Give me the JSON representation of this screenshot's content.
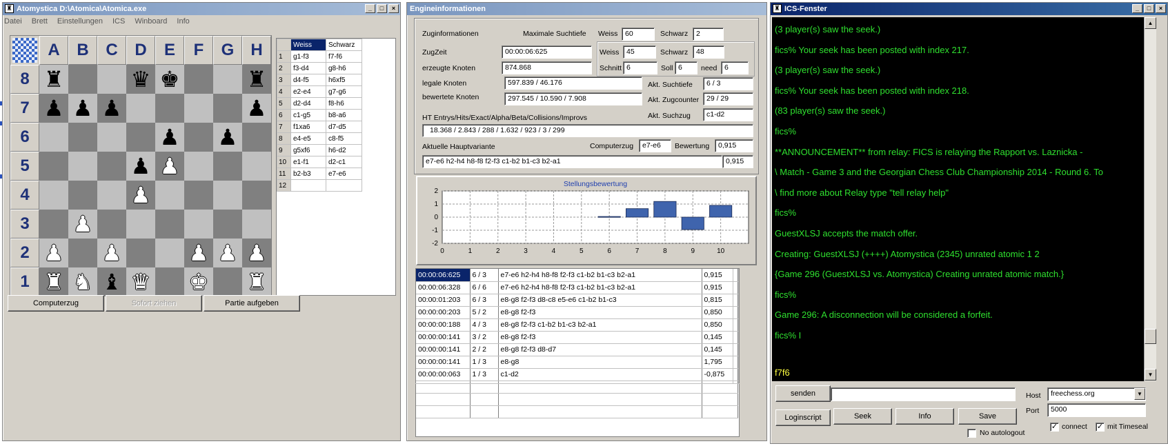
{
  "main_window": {
    "title": "Atomystica D:\\Atomica\\Atomica.exe",
    "menu": [
      "Datei",
      "Brett",
      "Einstellungen",
      "ICS",
      "Winboard",
      "Info"
    ],
    "files": [
      "A",
      "B",
      "C",
      "D",
      "E",
      "F",
      "G",
      "H"
    ],
    "ranks": [
      "8",
      "7",
      "6",
      "5",
      "4",
      "3",
      "2",
      "1"
    ],
    "board": [
      [
        "r",
        "",
        "",
        "q",
        "k",
        "",
        "",
        "r"
      ],
      [
        "p",
        "p",
        "p",
        "",
        "",
        "",
        "",
        "p"
      ],
      [
        "",
        "",
        "",
        "",
        "p",
        "",
        "p",
        ""
      ],
      [
        "",
        "",
        "",
        "p",
        "P",
        "",
        "",
        ""
      ],
      [
        "",
        "",
        "",
        "P",
        "",
        "",
        "",
        ""
      ],
      [
        "",
        "P",
        "",
        "",
        "",
        "",
        "",
        ""
      ],
      [
        "P",
        "",
        "P",
        "",
        "",
        "P",
        "P",
        "P"
      ],
      [
        "R",
        "N",
        "b",
        "Q",
        "",
        "K",
        "",
        "R"
      ]
    ],
    "moves_header": {
      "white": "Weiss",
      "black": "Schwarz"
    },
    "moves": [
      {
        "n": "1",
        "w": "g1-f3",
        "b": "f7-f6"
      },
      {
        "n": "2",
        "w": "f3-d4",
        "b": "g8-h6"
      },
      {
        "n": "3",
        "w": "d4-f5",
        "b": "h6xf5"
      },
      {
        "n": "4",
        "w": "e2-e4",
        "b": "g7-g6"
      },
      {
        "n": "5",
        "w": "d2-d4",
        "b": "f8-h6"
      },
      {
        "n": "6",
        "w": "c1-g5",
        "b": "b8-a6"
      },
      {
        "n": "7",
        "w": "f1xa6",
        "b": "d7-d5"
      },
      {
        "n": "8",
        "w": "e4-e5",
        "b": "c8-f5"
      },
      {
        "n": "9",
        "w": "g5xf6",
        "b": "h6-d2"
      },
      {
        "n": "10",
        "w": "e1-f1",
        "b": "d2-c1"
      },
      {
        "n": "11",
        "w": "b2-b3",
        "b": "e7-e6"
      },
      {
        "n": "12",
        "w": "",
        "b": ""
      }
    ],
    "buttons": {
      "computer_move": "Computerzug",
      "move_now": "Sofort ziehen",
      "resign": "Partie aufgeben"
    }
  },
  "engine_window": {
    "title": "Engineinformationen",
    "labels": {
      "zuginfo": "Zuginformationen",
      "max_depth": "Maximale Suchtiefe",
      "weiss": "Weiss",
      "schwarz": "Schwarz",
      "zugzeit": "ZugZeit",
      "schnitt": "Schnitt",
      "soll": "Soll",
      "need": "need",
      "erzeugte": "erzeugte Knoten",
      "legale": "legale Knoten",
      "bewertete": "bewertete Knoten",
      "akt_suchtiefe": "Akt. Suchtiefe",
      "akt_zugcounter": "Akt. Zugcounter",
      "akt_suchzug": "Akt. Suchzug",
      "ht": "HT Entrys/Hits/Exact/Alpha/Beta/Collisions/Improvs",
      "hauptvariante": "Aktuelle Hauptvariante",
      "computerzug": "Computerzug",
      "bewertung": "Bewertung"
    },
    "values": {
      "max_weiss": "60",
      "max_schwarz": "2",
      "zugzeit": "00:00:06:625",
      "time_weiss": "45",
      "time_schwarz": "48",
      "schnitt": "6",
      "soll": "6",
      "need": "6",
      "erzeugte": "874.868",
      "legale": "597.839 /    46.176",
      "bewertete": "297.545 /    10.590 /    7.908",
      "akt_suchtiefe": "6 / 3",
      "akt_zugcounter": "29 / 29",
      "akt_suchzug": "c1-d2",
      "ht": "18.368 /     2.843 /        288 /     1.632 /       923 /         3 /       299",
      "computerzug": "e7-e6",
      "bewertung": "0,915",
      "pv": "e7-e6  h2-h4  h8-f8  f2-f3  c1-b2  b1-c3  b2-a1",
      "pv_score": "0,915"
    },
    "history": [
      {
        "t": "00:00:06:625",
        "d": "6 / 3",
        "v": "e7-e6  h2-h4  h8-f8  f2-f3  c1-b2  b1-c3  b2-a1",
        "s": "0,915"
      },
      {
        "t": "00:00:06:328",
        "d": "6 / 6",
        "v": "e7-e6  h2-h4  h8-f8  f2-f3  c1-b2  b1-c3  b2-a1",
        "s": "0,915"
      },
      {
        "t": "00:00:01:203",
        "d": "6 / 3",
        "v": "e8-g8  f2-f3  d8-c8  e5-e6  c1-b2  b1-c3",
        "s": "0,815"
      },
      {
        "t": "00:00:00:203",
        "d": "5 / 2",
        "v": "e8-g8  f2-f3",
        "s": "0,850"
      },
      {
        "t": "00:00:00:188",
        "d": "4 / 3",
        "v": "e8-g8  f2-f3  c1-b2  b1-c3  b2-a1",
        "s": "0,850"
      },
      {
        "t": "00:00:00:141",
        "d": "3 / 2",
        "v": "e8-g8  f2-f3",
        "s": "0,145"
      },
      {
        "t": "00:00:00:141",
        "d": "2 / 2",
        "v": "e8-g8  f2-f3  d8-d7",
        "s": "0,145"
      },
      {
        "t": "00:00:00:141",
        "d": "1 / 3",
        "v": "e8-g8",
        "s": "1,795"
      },
      {
        "t": "00:00:00:063",
        "d": "1 / 3",
        "v": "c1-d2",
        "s": "-0,875"
      }
    ]
  },
  "chart_data": {
    "type": "bar",
    "title": "Stellungsbewertung",
    "x": [
      1,
      2,
      3,
      4,
      5,
      6,
      7,
      8,
      9,
      10
    ],
    "values": [
      0,
      0,
      0,
      0,
      0,
      0.05,
      0.65,
      1.2,
      -0.95,
      0.9
    ],
    "xlim": [
      0,
      11
    ],
    "ylim": [
      -2,
      2
    ],
    "xticks": [
      "0",
      "1",
      "2",
      "3",
      "4",
      "5",
      "6",
      "7",
      "8",
      "9",
      "10"
    ],
    "yticks": [
      "2",
      "1",
      "0",
      "-1",
      "-2"
    ],
    "bar_color": "#3f64ad",
    "grid": true
  },
  "ics_window": {
    "title": "ICS-Fenster",
    "lines": [
      "(3 player(s) saw the seek.)",
      "fics% Your seek has been posted with index 217.",
      "(3 player(s) saw the seek.)",
      "fics% Your seek has been posted with index 218.",
      "(83 player(s) saw the seek.)",
      "fics%",
      "    **ANNOUNCEMENT** from relay: FICS is relaying the Rapport vs. Laznicka -",
      "\\   Match - Game 3 and the Georgian Chess Club Championship 2014 - Round 6. To",
      "\\   find more about Relay type \"tell relay help\"",
      "fics%",
      "GuestXLSJ accepts the match offer.",
      "Creating: GuestXLSJ (++++) Atomystica (2345) unrated atomic 1 2",
      "{Game 296 (GuestXLSJ vs. Atomystica) Creating unrated atomic match.}",
      "fics%",
      "Game 296: A disconnection will be considered a forfeit.",
      "fics% I"
    ],
    "input_echo": "f7f6",
    "buttons": {
      "send": "senden",
      "login": "Loginscript",
      "seek": "Seek",
      "info": "Info",
      "save": "Save"
    },
    "host_label": "Host",
    "host_value": "freechess.org",
    "port_label": "Port",
    "port_value": "5000",
    "no_autologout": "No autologout",
    "connect": "connect",
    "timeseal": "mit Timeseal",
    "command_value": ""
  }
}
